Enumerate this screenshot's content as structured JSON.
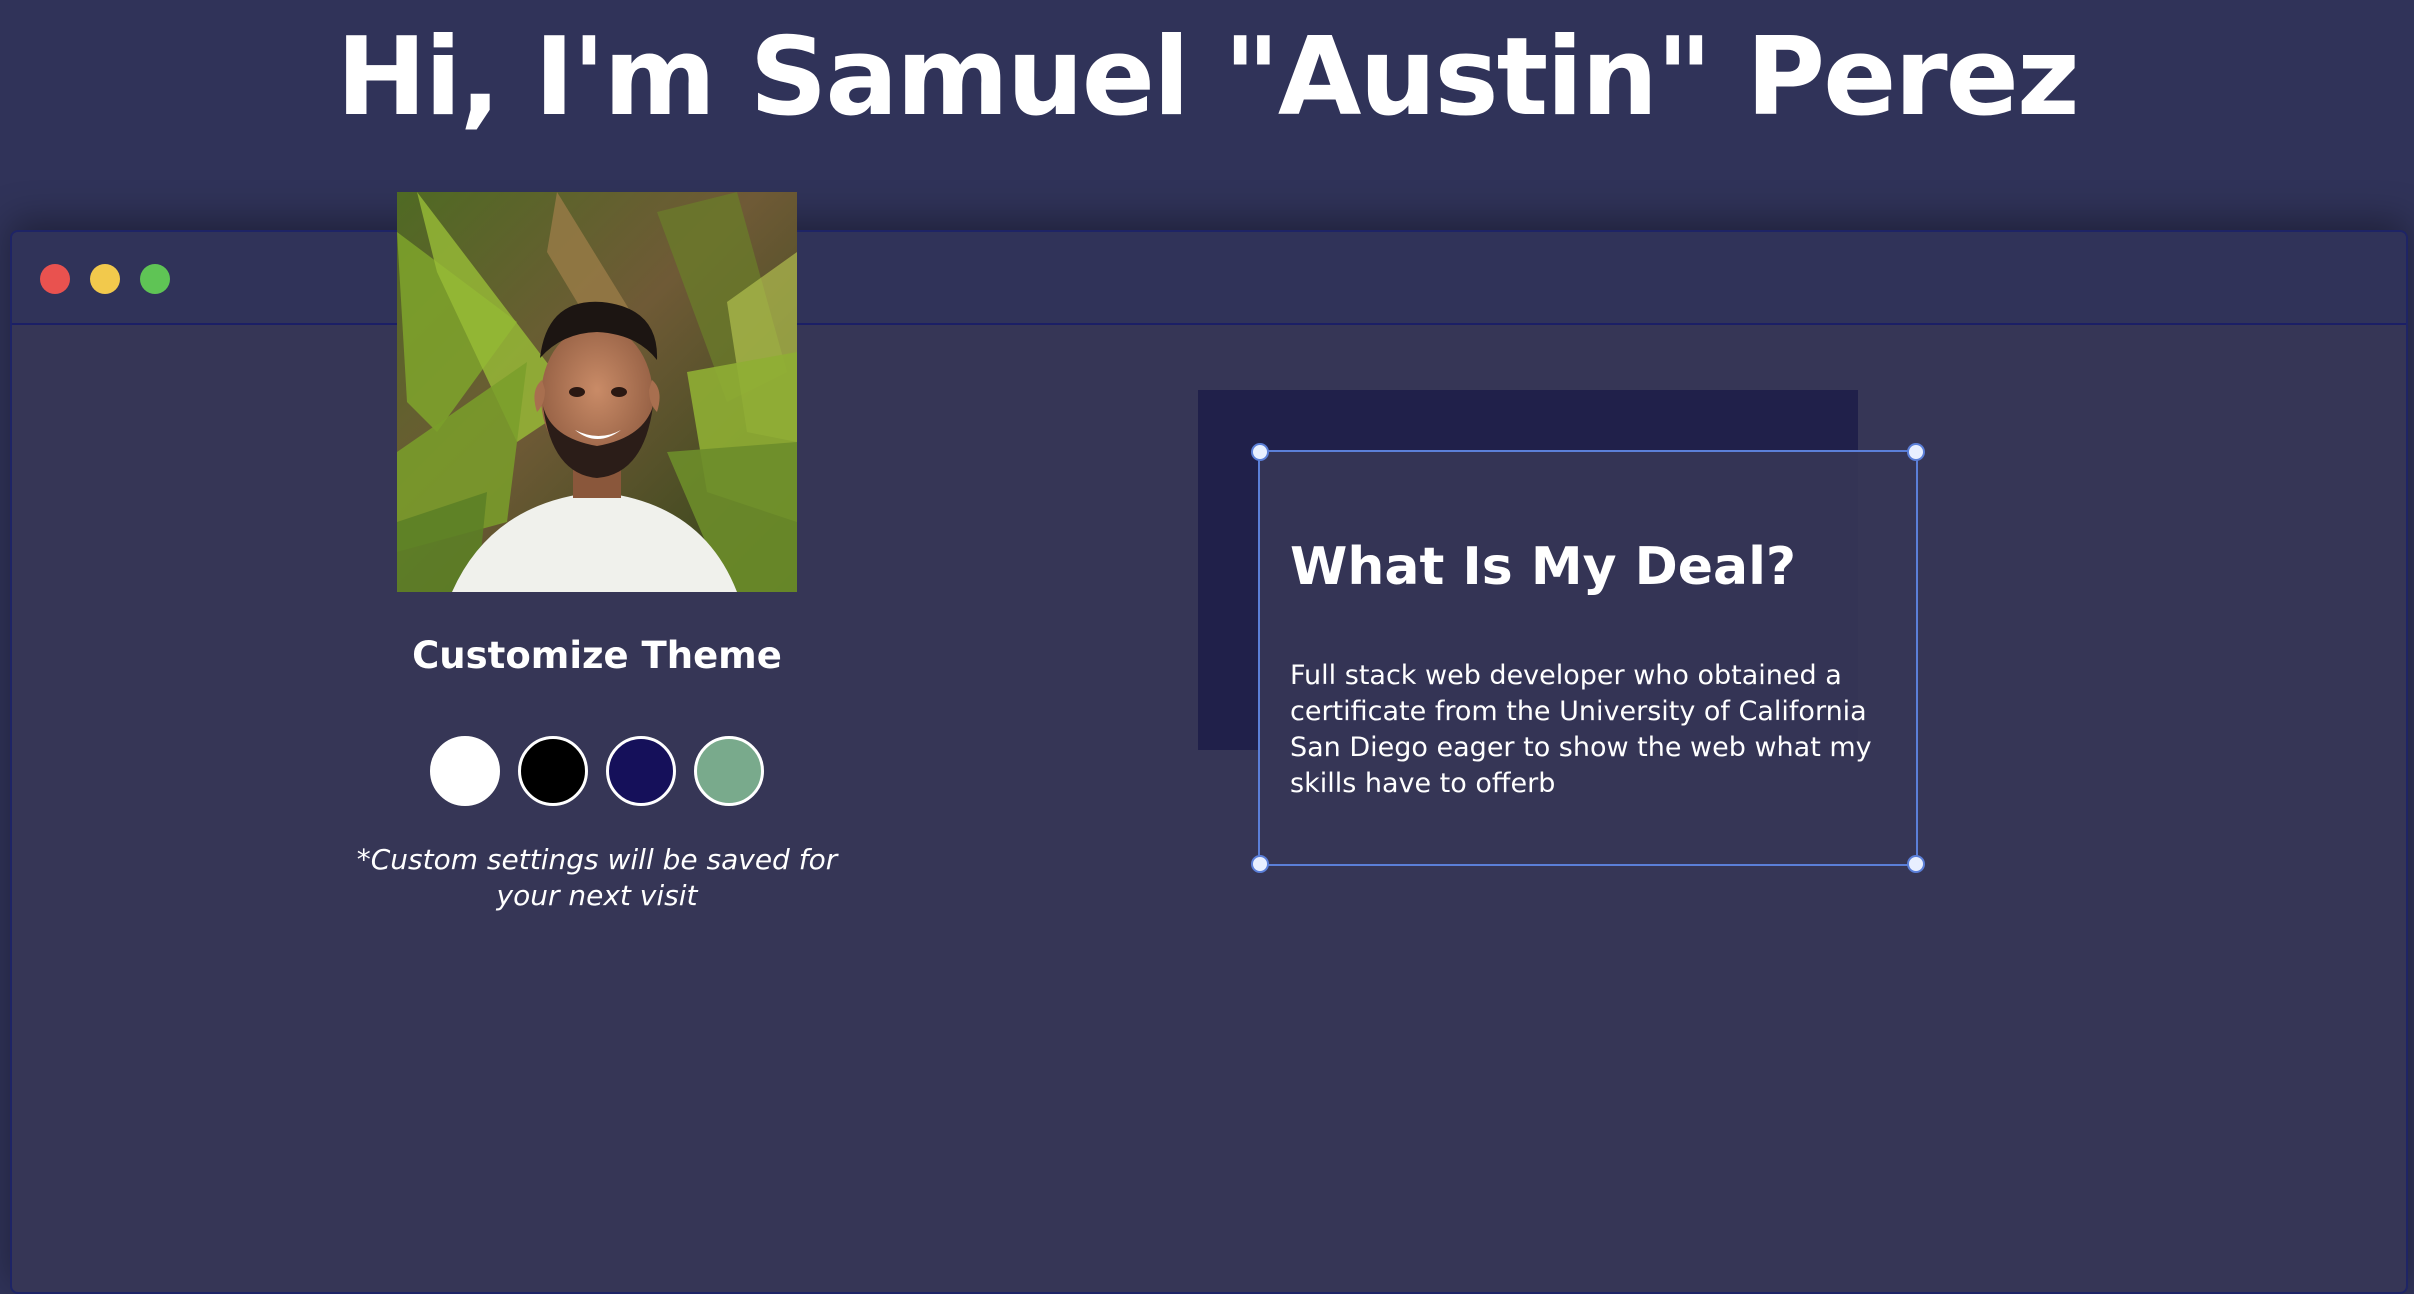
{
  "header": {
    "title": "Hi, I'm Samuel \"Austin\" Perez"
  },
  "window": {
    "controls": [
      {
        "name": "close",
        "color": "#e9524f"
      },
      {
        "name": "minimize",
        "color": "#f2c94c"
      },
      {
        "name": "maximize",
        "color": "#5fc455"
      }
    ]
  },
  "profile": {
    "photo_icon": "profile-photo"
  },
  "theme": {
    "title": "Customize Theme",
    "swatches": [
      {
        "name": "white",
        "color": "#ffffff"
      },
      {
        "name": "black",
        "color": "#000000"
      },
      {
        "name": "navy",
        "color": "#15105a"
      },
      {
        "name": "sage",
        "color": "#79aa8c"
      }
    ],
    "note": "*Custom settings will be saved for your next visit"
  },
  "about": {
    "title": "What Is My Deal?",
    "text": "Full stack web developer who obtained a certificate from the University of California San Diego eager to show the web what my skills have to offerb"
  },
  "colors": {
    "page_background": "#303359",
    "window_background": "#363656",
    "accent_border": "#5b7fd8",
    "shadow_box": "#20204a"
  }
}
